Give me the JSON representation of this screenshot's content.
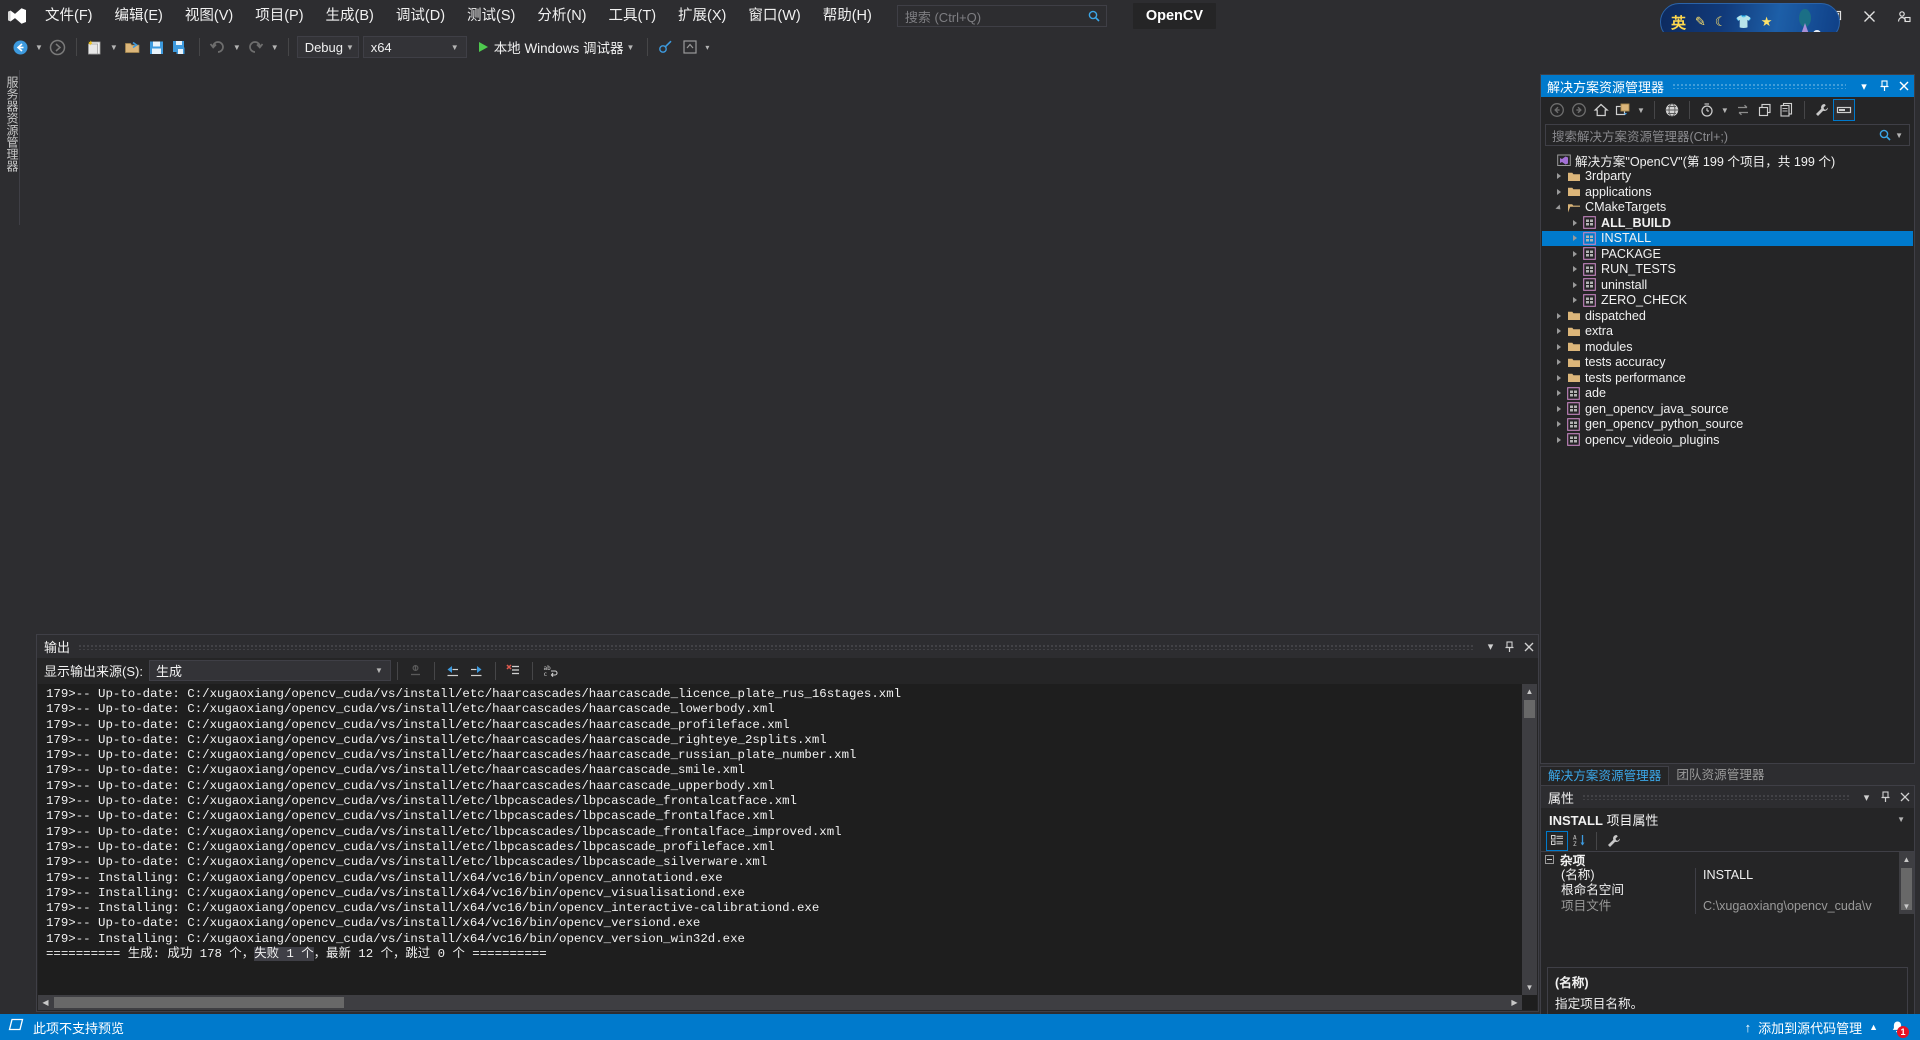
{
  "menubar": {
    "logo_name": "visual-studio-logo",
    "items": [
      {
        "label": "文件(F)"
      },
      {
        "label": "编辑(E)"
      },
      {
        "label": "视图(V)"
      },
      {
        "label": "项目(P)"
      },
      {
        "label": "生成(B)"
      },
      {
        "label": "调试(D)"
      },
      {
        "label": "测试(S)"
      },
      {
        "label": "分析(N)"
      },
      {
        "label": "工具(T)"
      },
      {
        "label": "扩展(X)"
      },
      {
        "label": "窗口(W)"
      },
      {
        "label": "帮助(H)"
      }
    ],
    "search_placeholder": "搜索 (Ctrl+Q)",
    "solution_badge": "OpenCV",
    "share_label": "Share",
    "ime": {
      "mode": "英",
      "icons": [
        "pen-icon",
        "moon-icon",
        "shirt-icon",
        "star-icon",
        "star-small-icon"
      ]
    }
  },
  "toolbar": {
    "navigate_back": "后退",
    "navigate_forward": "前进",
    "new_item": "新建项",
    "open_file": "打开文件",
    "save": "保存",
    "save_all": "全部保存",
    "undo": "撤消",
    "redo": "恢复",
    "config_value": "Debug",
    "platform_value": "x64",
    "run_label": "本地 Windows 调试器"
  },
  "left_dock": {
    "server_explorer_tab": "服务器资源管理器"
  },
  "output": {
    "title": "输出",
    "source_label": "显示输出来源(S):",
    "source_value": "生成",
    "toolbar_buttons": [
      "find-message-icon",
      "go-to-previous-message-icon",
      "go-to-next-message-icon",
      "clear-all-icon",
      "toggle-word-wrap-icon"
    ],
    "lines": [
      "179>-- Up-to-date: C:/xugaoxiang/opencv_cuda/vs/install/etc/haarcascades/haarcascade_licence_plate_rus_16stages.xml",
      "179>-- Up-to-date: C:/xugaoxiang/opencv_cuda/vs/install/etc/haarcascades/haarcascade_lowerbody.xml",
      "179>-- Up-to-date: C:/xugaoxiang/opencv_cuda/vs/install/etc/haarcascades/haarcascade_profileface.xml",
      "179>-- Up-to-date: C:/xugaoxiang/opencv_cuda/vs/install/etc/haarcascades/haarcascade_righteye_2splits.xml",
      "179>-- Up-to-date: C:/xugaoxiang/opencv_cuda/vs/install/etc/haarcascades/haarcascade_russian_plate_number.xml",
      "179>-- Up-to-date: C:/xugaoxiang/opencv_cuda/vs/install/etc/haarcascades/haarcascade_smile.xml",
      "179>-- Up-to-date: C:/xugaoxiang/opencv_cuda/vs/install/etc/haarcascades/haarcascade_upperbody.xml",
      "179>-- Up-to-date: C:/xugaoxiang/opencv_cuda/vs/install/etc/lbpcascades/lbpcascade_frontalcatface.xml",
      "179>-- Up-to-date: C:/xugaoxiang/opencv_cuda/vs/install/etc/lbpcascades/lbpcascade_frontalface.xml",
      "179>-- Up-to-date: C:/xugaoxiang/opencv_cuda/vs/install/etc/lbpcascades/lbpcascade_frontalface_improved.xml",
      "179>-- Up-to-date: C:/xugaoxiang/opencv_cuda/vs/install/etc/lbpcascades/lbpcascade_profileface.xml",
      "179>-- Up-to-date: C:/xugaoxiang/opencv_cuda/vs/install/etc/lbpcascades/lbpcascade_silverware.xml",
      "179>-- Installing: C:/xugaoxiang/opencv_cuda/vs/install/x64/vc16/bin/opencv_annotationd.exe",
      "179>-- Installing: C:/xugaoxiang/opencv_cuda/vs/install/x64/vc16/bin/opencv_visualisationd.exe",
      "179>-- Installing: C:/xugaoxiang/opencv_cuda/vs/install/x64/vc16/bin/opencv_interactive-calibrationd.exe",
      "179>-- Up-to-date: C:/xugaoxiang/opencv_cuda/vs/install/x64/vc16/bin/opencv_versiond.exe",
      "179>-- Installing: C:/xugaoxiang/opencv_cuda/vs/install/x64/vc16/bin/opencv_version_win32d.exe"
    ],
    "summary": {
      "prefix": "========== 生成: 成功 178 个，",
      "highlight": "失败 1 个",
      "suffix": "，最新 12 个，跳过 0 个 =========="
    }
  },
  "solution_explorer": {
    "title": "解决方案资源管理器",
    "search_placeholder": "搜索解决方案资源管理器(Ctrl+;)",
    "toolbar_buttons": [
      "back-icon",
      "forward-icon",
      "home-icon",
      "switch-views-icon",
      "pending-changes-filter-icon",
      "sync-with-active-document-icon",
      "refresh-icon",
      "collapse-all-icon",
      "show-all-files-icon",
      "properties-wrench-icon",
      "preview-selected-items-icon"
    ],
    "root": "解决方案\"OpenCV\"(第 199 个项目，共 199 个)",
    "tree": [
      {
        "label": "3rdparty",
        "icon": "folder-icon",
        "depth": 1,
        "state": "collapsed",
        "selected": false,
        "bold": false
      },
      {
        "label": "applications",
        "icon": "folder-icon",
        "depth": 1,
        "state": "collapsed",
        "selected": false,
        "bold": false
      },
      {
        "label": "CMakeTargets",
        "icon": "folder-open-icon",
        "depth": 1,
        "state": "expanded",
        "selected": false,
        "bold": false
      },
      {
        "label": "ALL_BUILD",
        "icon": "project-icon",
        "depth": 2,
        "state": "collapsed",
        "selected": false,
        "bold": true
      },
      {
        "label": "INSTALL",
        "icon": "project-icon",
        "depth": 2,
        "state": "collapsed",
        "selected": true,
        "bold": false
      },
      {
        "label": "PACKAGE",
        "icon": "project-icon",
        "depth": 2,
        "state": "collapsed",
        "selected": false,
        "bold": false
      },
      {
        "label": "RUN_TESTS",
        "icon": "project-icon",
        "depth": 2,
        "state": "collapsed",
        "selected": false,
        "bold": false
      },
      {
        "label": "uninstall",
        "icon": "project-icon",
        "depth": 2,
        "state": "collapsed",
        "selected": false,
        "bold": false
      },
      {
        "label": "ZERO_CHECK",
        "icon": "project-icon",
        "depth": 2,
        "state": "collapsed",
        "selected": false,
        "bold": false
      },
      {
        "label": "dispatched",
        "icon": "folder-icon",
        "depth": 1,
        "state": "collapsed",
        "selected": false,
        "bold": false
      },
      {
        "label": "extra",
        "icon": "folder-icon",
        "depth": 1,
        "state": "collapsed",
        "selected": false,
        "bold": false
      },
      {
        "label": "modules",
        "icon": "folder-icon",
        "depth": 1,
        "state": "collapsed",
        "selected": false,
        "bold": false
      },
      {
        "label": "tests accuracy",
        "icon": "folder-icon",
        "depth": 1,
        "state": "collapsed",
        "selected": false,
        "bold": false
      },
      {
        "label": "tests performance",
        "icon": "folder-icon",
        "depth": 1,
        "state": "collapsed",
        "selected": false,
        "bold": false
      },
      {
        "label": "ade",
        "icon": "project-icon",
        "depth": 1,
        "state": "collapsed",
        "selected": false,
        "bold": false
      },
      {
        "label": "gen_opencv_java_source",
        "icon": "project-icon",
        "depth": 1,
        "state": "collapsed",
        "selected": false,
        "bold": false
      },
      {
        "label": "gen_opencv_python_source",
        "icon": "project-icon",
        "depth": 1,
        "state": "collapsed",
        "selected": false,
        "bold": false
      },
      {
        "label": "opencv_videoio_plugins",
        "icon": "project-icon",
        "depth": 1,
        "state": "collapsed",
        "selected": false,
        "bold": false
      }
    ]
  },
  "dock_tabs": [
    {
      "label": "解决方案资源管理器",
      "active": true
    },
    {
      "label": "团队资源管理器",
      "active": false
    }
  ],
  "properties": {
    "title": "属性",
    "object_name": "INSTALL",
    "object_suffix": "项目属性",
    "toolbar_buttons": [
      "categorized-icon",
      "alphabetical-icon",
      "property-pages-icon"
    ],
    "category": "杂项",
    "rows": [
      {
        "name": "(名称)",
        "value": "INSTALL",
        "dim": false
      },
      {
        "name": "根命名空间",
        "value": "",
        "dim": false
      },
      {
        "name": "项目文件",
        "value": "C:\\xugaoxiang\\opencv_cuda\\v",
        "dim": true
      }
    ],
    "description_title": "(名称)",
    "description_text": "指定项目名称。"
  },
  "statusbar": {
    "message": "此项不支持预览",
    "source_control": "添加到源代码管理",
    "notification_count": "1"
  },
  "colors": {
    "accent": "#007acc",
    "background": "#2d2d30",
    "panel": "#252526",
    "editor": "#1e1e1e",
    "error_red": "#e81123",
    "folder": "#dcb67a",
    "project_purple": "#c586c0"
  }
}
